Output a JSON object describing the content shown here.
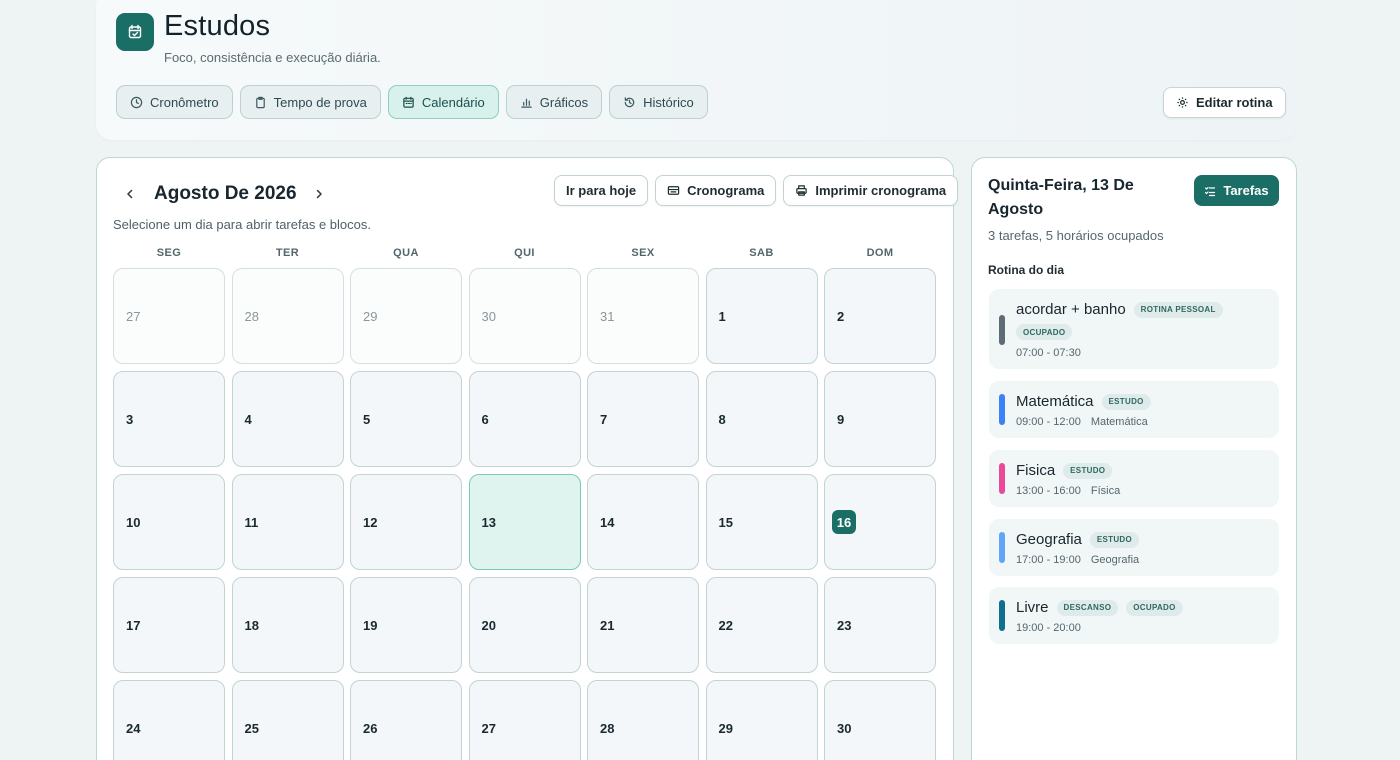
{
  "app": {
    "title": "Estudos",
    "subtitle": "Foco, consistência e execução diária."
  },
  "nav": {
    "tabs": [
      {
        "label": "Cronômetro",
        "icon": "clock-icon",
        "active": false
      },
      {
        "label": "Tempo de prova",
        "icon": "clipboard-icon",
        "active": false
      },
      {
        "label": "Calendário",
        "icon": "calendar-icon",
        "active": true
      },
      {
        "label": "Gráficos",
        "icon": "bar-chart-icon",
        "active": false
      },
      {
        "label": "Histórico",
        "icon": "history-icon",
        "active": false
      }
    ],
    "edit_routine": "Editar rotina"
  },
  "calendar": {
    "month_title": "Agosto De 2026",
    "hint": "Selecione um dia para abrir tarefas e blocos.",
    "actions": {
      "today": "Ir para hoje",
      "schedule": "Cronograma",
      "print": "Imprimir cronograma"
    },
    "weekdays": [
      "SEG",
      "TER",
      "QUA",
      "QUI",
      "SEX",
      "SAB",
      "DOM"
    ],
    "days": [
      {
        "n": "27",
        "muted": true
      },
      {
        "n": "28",
        "muted": true
      },
      {
        "n": "29",
        "muted": true
      },
      {
        "n": "30",
        "muted": true
      },
      {
        "n": "31",
        "muted": true
      },
      {
        "n": "1"
      },
      {
        "n": "2"
      },
      {
        "n": "3"
      },
      {
        "n": "4"
      },
      {
        "n": "5"
      },
      {
        "n": "6"
      },
      {
        "n": "7"
      },
      {
        "n": "8"
      },
      {
        "n": "9"
      },
      {
        "n": "10"
      },
      {
        "n": "11"
      },
      {
        "n": "12"
      },
      {
        "n": "13",
        "selected": true
      },
      {
        "n": "14"
      },
      {
        "n": "15"
      },
      {
        "n": "16",
        "today": true
      },
      {
        "n": "17"
      },
      {
        "n": "18"
      },
      {
        "n": "19"
      },
      {
        "n": "20"
      },
      {
        "n": "21"
      },
      {
        "n": "22"
      },
      {
        "n": "23"
      },
      {
        "n": "24"
      },
      {
        "n": "25"
      },
      {
        "n": "26"
      },
      {
        "n": "27"
      },
      {
        "n": "28"
      },
      {
        "n": "29"
      },
      {
        "n": "30"
      }
    ]
  },
  "side": {
    "date_title": "Quinta-Feira, 13 De Agosto",
    "summary": "3 tarefas, 5 horários ocupados",
    "tasks_button": "Tarefas",
    "routine_heading": "Rotina do dia",
    "routine": [
      {
        "title": "acordar + banho",
        "tags": [
          "ROTINA PESSOAL",
          "OCUPADO"
        ],
        "time": "07:00 - 07:30",
        "subject": "",
        "color": "#5f6b75"
      },
      {
        "title": "Matemática",
        "tags": [
          "ESTUDO"
        ],
        "time": "09:00 - 12:00",
        "subject": "Matemática",
        "color": "#3b82f6"
      },
      {
        "title": "Fisica",
        "tags": [
          "ESTUDO"
        ],
        "time": "13:00 - 16:00",
        "subject": "Física",
        "color": "#ec4899"
      },
      {
        "title": "Geografia",
        "tags": [
          "ESTUDO"
        ],
        "time": "17:00 - 19:00",
        "subject": "Geografia",
        "color": "#60a5fa"
      },
      {
        "title": "Livre",
        "tags": [
          "DESCANSO",
          "OCUPADO"
        ],
        "time": "19:00 - 20:00",
        "subject": "",
        "color": "#0f6f8f"
      }
    ]
  }
}
